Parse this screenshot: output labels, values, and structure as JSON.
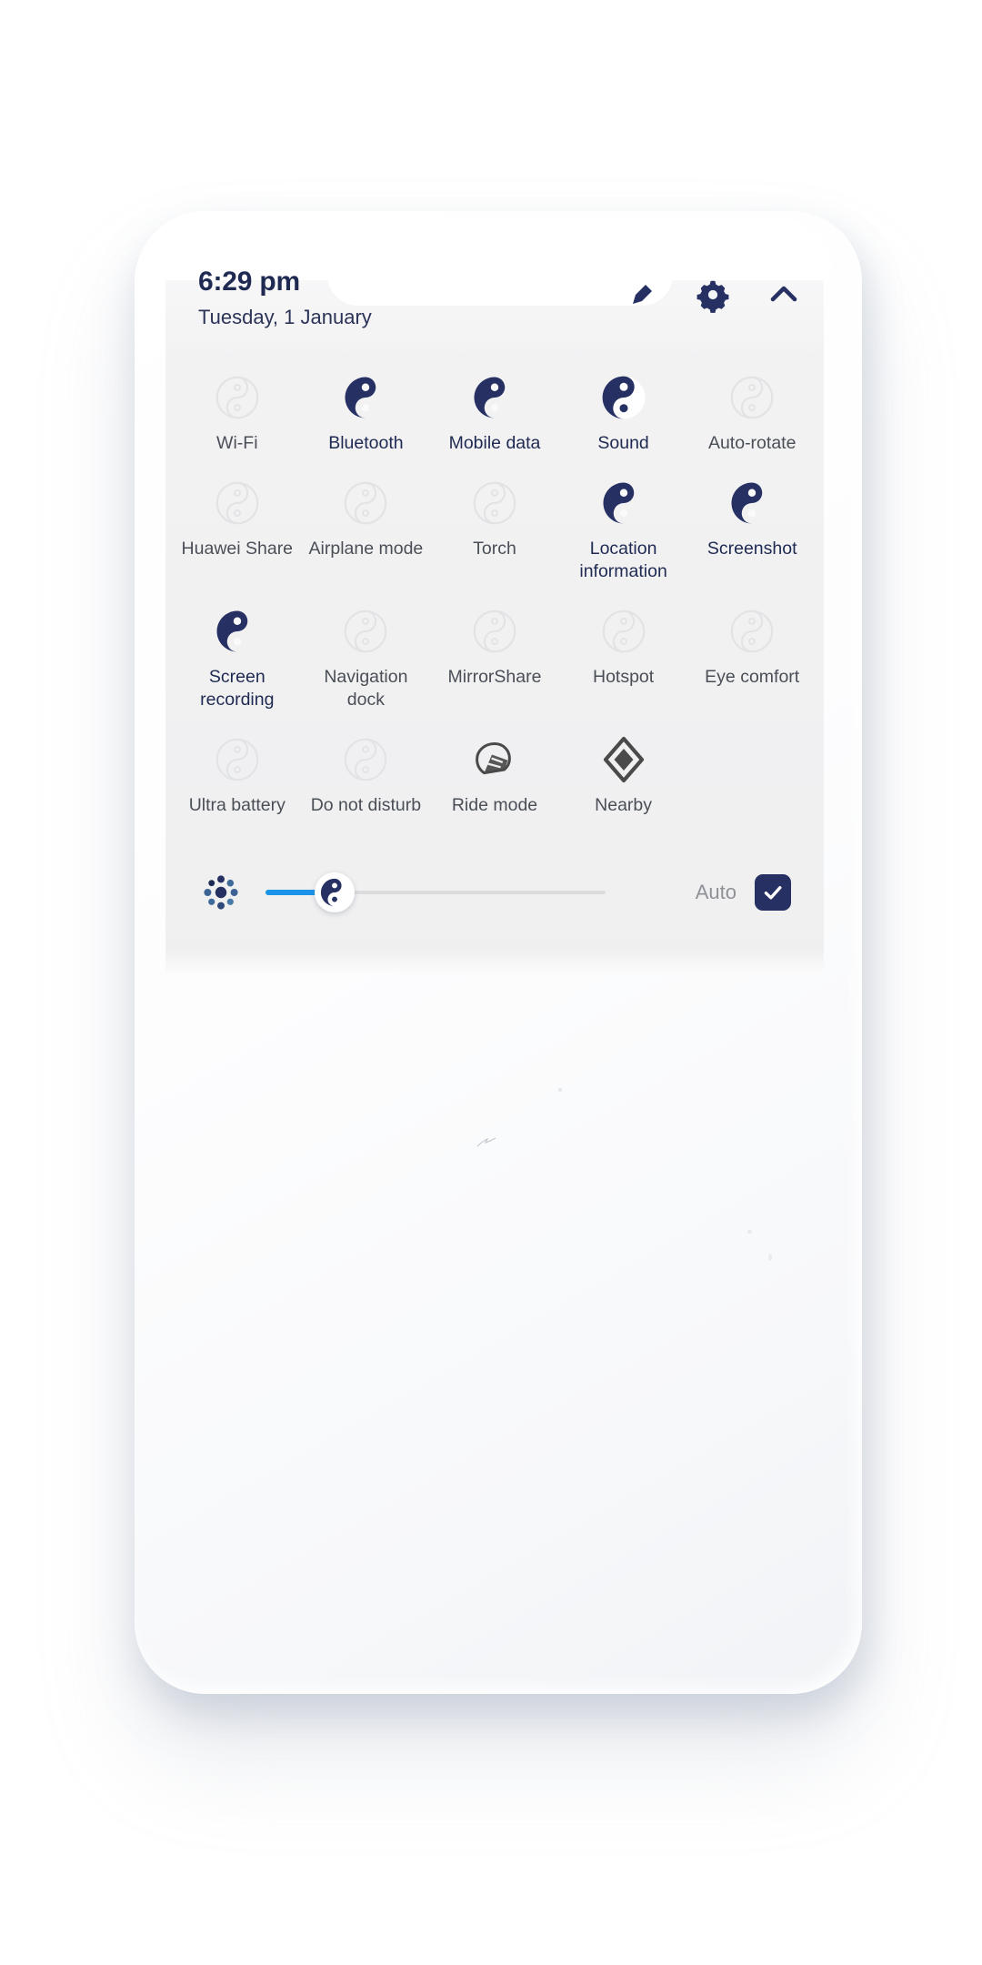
{
  "colors": {
    "accent_on": "#263062",
    "accent_off": "#e3e4e6",
    "slider_fill": "#1a93e8",
    "neutral_icon": "#4a4a4a",
    "panel_bg": "#f0f0f1",
    "label_on": "#1f2a52",
    "label_off": "#4a4f57"
  },
  "status_bar": {
    "time": "6:29 pm",
    "date": "Tuesday, 1 January"
  },
  "header_actions": [
    {
      "name": "edit-icon",
      "label": "Edit"
    },
    {
      "name": "gear-icon",
      "label": "Settings"
    },
    {
      "name": "chevron-up-icon",
      "label": "Collapse"
    }
  ],
  "quick_settings": {
    "tiles": [
      {
        "label": "Wi-Fi",
        "state": "off",
        "icon": "yin-yang-icon"
      },
      {
        "label": "Bluetooth",
        "state": "on",
        "icon": "yin-yang-icon"
      },
      {
        "label": "Mobile data",
        "state": "on",
        "icon": "yin-yang-icon"
      },
      {
        "label": "Sound",
        "state": "on",
        "icon": "yin-yang-filled-icon"
      },
      {
        "label": "Auto-rotate",
        "state": "off",
        "icon": "yin-yang-icon"
      },
      {
        "label": "Huawei Share",
        "state": "off",
        "icon": "yin-yang-icon"
      },
      {
        "label": "Airplane mode",
        "state": "off",
        "icon": "yin-yang-icon"
      },
      {
        "label": "Torch",
        "state": "off",
        "icon": "yin-yang-icon"
      },
      {
        "label": "Location information",
        "state": "on",
        "icon": "yin-yang-icon"
      },
      {
        "label": "Screenshot",
        "state": "on",
        "icon": "yin-yang-icon"
      },
      {
        "label": "Screen recording",
        "state": "on",
        "icon": "yin-yang-icon"
      },
      {
        "label": "Navigation dock",
        "state": "off",
        "icon": "yin-yang-icon"
      },
      {
        "label": "MirrorShare",
        "state": "off",
        "icon": "yin-yang-icon"
      },
      {
        "label": "Hotspot",
        "state": "off",
        "icon": "yin-yang-icon"
      },
      {
        "label": "Eye comfort",
        "state": "off",
        "icon": "yin-yang-icon"
      },
      {
        "label": "Ultra battery",
        "state": "off",
        "icon": "yin-yang-icon"
      },
      {
        "label": "Do not disturb",
        "state": "off",
        "icon": "yin-yang-icon"
      },
      {
        "label": "Ride mode",
        "state": "neutral",
        "icon": "helmet-icon"
      },
      {
        "label": "Nearby",
        "state": "neutral",
        "icon": "diamond-icon"
      }
    ]
  },
  "brightness": {
    "icon": "brightness-dots-icon",
    "value_percent": 12,
    "auto_label": "Auto",
    "auto_checked": true
  }
}
